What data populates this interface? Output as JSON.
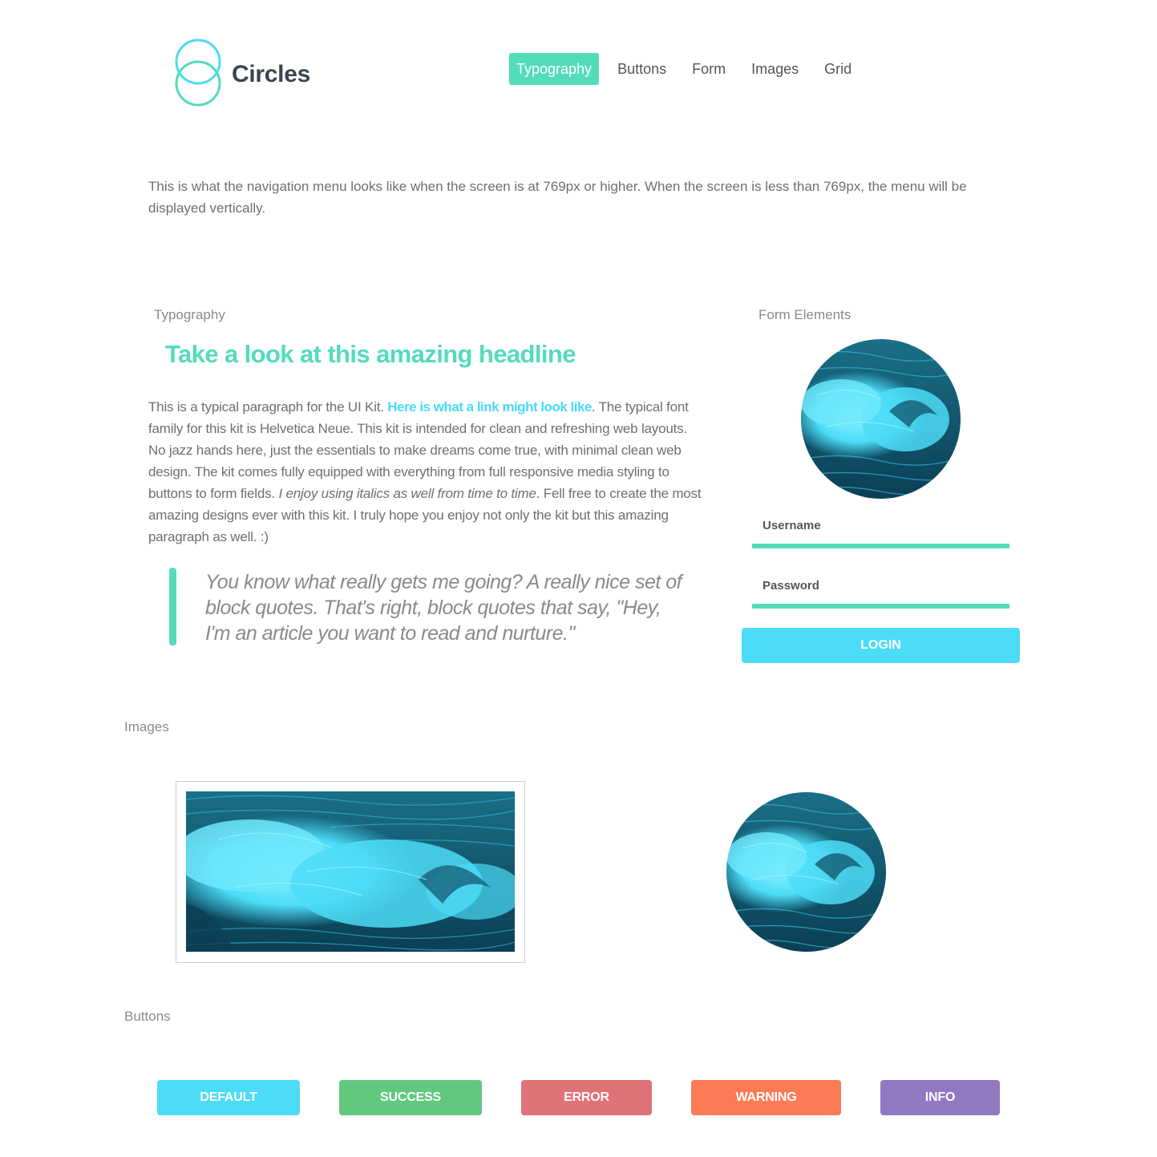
{
  "brand": {
    "name": "Circles",
    "logo_icon": "double-circle-logo-icon"
  },
  "nav": {
    "items": [
      {
        "label": "Typography",
        "active": true
      },
      {
        "label": "Buttons",
        "active": false
      },
      {
        "label": "Form",
        "active": false
      },
      {
        "label": "Images",
        "active": false
      },
      {
        "label": "Grid",
        "active": false
      }
    ]
  },
  "intro": "This is what the navigation menu looks like when the screen is at 769px or higher. When the screen is less than 769px, the menu will be displayed vertically.",
  "typography": {
    "label": "Typography",
    "headline": "Take a look at this amazing headline",
    "paragraph": {
      "before_link": "This is a typical paragraph for the UI Kit. ",
      "link": "Here is what a link might look like",
      "after_link": ". The typical font family for this kit is Helvetica Neue. This kit is intended for clean and refreshing web layouts. No jazz hands here, just the essentials to make dreams come true, with minimal clean web design. The kit comes fully equipped with everything from full responsive media styling to buttons to form fields. ",
      "italic": "I enjoy using italics as well from time to time",
      "after_italic": ". Fell free to create the most amazing designs ever with this kit. I truly hope you enjoy not only the kit but this amazing paragraph as well. :)"
    },
    "blockquote": "You know what really gets me going? A really nice set of block quotes. That's right, block quotes that say, \"Hey, I'm an article you want to read and nurture.\""
  },
  "form": {
    "label": "Form Elements",
    "username_label": "Username",
    "password_label": "Password",
    "username_value": "",
    "password_value": "",
    "login_label": "LOGIN"
  },
  "images": {
    "label": "Images"
  },
  "buttons": {
    "label": "Buttons",
    "items": [
      {
        "label": "DEFAULT",
        "color": "#4cdcf7"
      },
      {
        "label": "SUCCESS",
        "color": "#62c87e"
      },
      {
        "label": "ERROR",
        "color": "#e07377"
      },
      {
        "label": "WARNING",
        "color": "#fb7b57"
      },
      {
        "label": "INFO",
        "color": "#9278c1"
      }
    ]
  },
  "colors": {
    "accent": "#53dcbc",
    "link": "#48dbf7",
    "text": "#6f6f6f"
  }
}
